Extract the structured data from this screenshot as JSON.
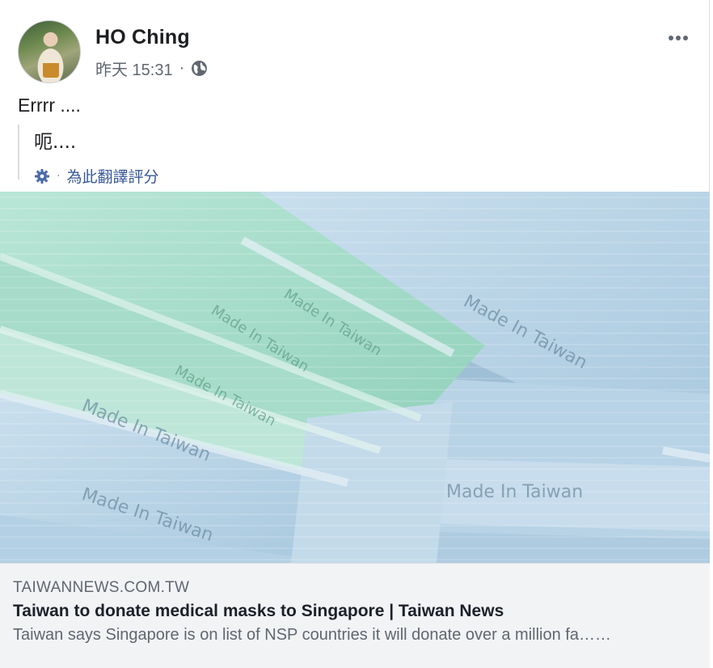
{
  "post": {
    "author": "HO Ching",
    "timestamp": "昨天 15:31",
    "separator": "·",
    "privacy_icon": "globe-icon",
    "more_icon": "more-options-icon",
    "text": "Errrr ....",
    "translation": {
      "text": "呃....",
      "rate_label": "為此翻譯評分",
      "rate_icon": "gear-icon",
      "separator": "·"
    }
  },
  "link_preview": {
    "image_text": [
      "Made In Taiwan"
    ],
    "domain": "TAIWANNEWS.COM.TW",
    "title": "Taiwan to donate medical masks to Singapore | Taiwan News",
    "description": "Taiwan says Singapore is on list of NSP countries it will donate over a million fa……"
  },
  "colors": {
    "link_blue": "#385898",
    "secondary_text": "#606770",
    "caption_bg": "#f2f3f5",
    "mask_blue": "#bcd6e8",
    "mask_green": "#a9dccb"
  }
}
